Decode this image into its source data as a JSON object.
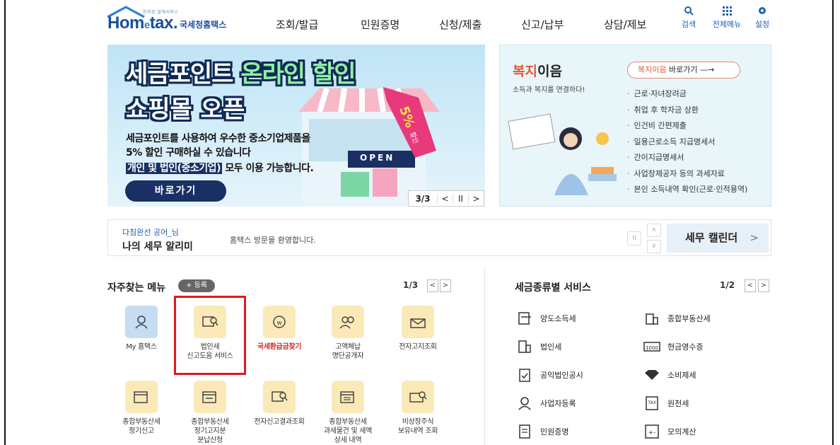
{
  "header": {
    "logo_tagline": "친지랑 발해서비스",
    "logo_brand_home": "Hom",
    "logo_brand_e": "e",
    "logo_brand_tax": "tax.",
    "logo_agency": "국세청홈택스",
    "gnb": [
      "조회/발급",
      "민원증명",
      "신청/제출",
      "신고/납부",
      "상담/제보"
    ],
    "utils": [
      {
        "label": "검색",
        "icon": "search-icon"
      },
      {
        "label": "전체메뉴",
        "icon": "grid-menu-icon"
      },
      {
        "label": "설정",
        "icon": "gear-icon"
      }
    ]
  },
  "banner": {
    "title_line1_a": "세금포인트 ",
    "title_line1_b": "온라인 할인",
    "title_line2": "쇼핑몰 오픈",
    "line1": "세금포인트를 사용하여 우수한 중소기업제품을",
    "line2": "5% 할인 구매하실 수 있습니다",
    "line3_hl": "개인 및 법인(중소기업)",
    "line3_rest": " 모두 이용 가능합니다.",
    "tag_text": "5%",
    "tag_sub": "할인",
    "open_sign": "OPEN",
    "button": "바로가기",
    "page": "3/3",
    "prev": "<",
    "pause": "II",
    "next": ">"
  },
  "welfare": {
    "title_a": "복지",
    "title_b": "이음",
    "subtitle": "소득과 복지를 연결하다!",
    "go_a": "복지이음",
    "go_b": " 바로가기  —→",
    "items": [
      "근로·자녀장려금",
      "취업 후 학자금 상환",
      "인건비 간편제출",
      "일용근로소득 지급명세서",
      "간이지급명세서",
      "사업장제공자 등의 과세자료",
      "본인 소득내역 확인(근로·인적용역)"
    ]
  },
  "notice": {
    "user": "다침완선 공어_님",
    "title": "나의 세무 알리미",
    "message": "홈택스 방문을 환영합니다.",
    "pause": "II",
    "up": "∧",
    "down": "∨",
    "calendar": "세무 캘린더",
    "calendar_arrow": ">"
  },
  "frequent": {
    "title": "자주찾는 메뉴",
    "add": "+ 등록",
    "page": "1/3",
    "prev": "<",
    "next": ">",
    "items": [
      {
        "label": "My 홈택스",
        "icon": "user-icon"
      },
      {
        "label": "법인세\n신고도움 서비스",
        "icon": "document-search-icon"
      },
      {
        "label": "국세환급금찾기",
        "icon": "refund-coin-icon"
      },
      {
        "label": "고액체납\n명단공개자",
        "icon": "people-icon"
      },
      {
        "label": "전자고지조회",
        "icon": "envelope-icon"
      },
      {
        "label": "종합부동산세\n정기신고",
        "icon": "calendar-pen-icon"
      },
      {
        "label": "종합부동산세\n정기고지분\n분납신청",
        "icon": "calendar-check-icon"
      },
      {
        "label": "전자신고결과조회",
        "icon": "document-search-icon"
      },
      {
        "label": "종합부동산세\n과세물건 및 세액\n상세 내역",
        "icon": "calendar-list-icon"
      },
      {
        "label": "비상장주식\n보유내역 조회",
        "icon": "stock-search-icon"
      }
    ]
  },
  "tax_services": {
    "title": "세금종류별 서비스",
    "page": "1/2",
    "prev": "<",
    "next": ">",
    "items": [
      {
        "label": "양도소득세",
        "icon": "transfer-doc-icon"
      },
      {
        "label": "종합부동산세",
        "icon": "building-icon"
      },
      {
        "label": "법인세",
        "icon": "corporation-icon"
      },
      {
        "label": "현금영수증",
        "icon": "receipt-icon"
      },
      {
        "label": "공익법인공시",
        "icon": "clipboard-icon"
      },
      {
        "label": "소비제세",
        "icon": "diamond-icon"
      },
      {
        "label": "사업자등록",
        "icon": "person-icon"
      },
      {
        "label": "원천세",
        "icon": "tax-doc-icon"
      },
      {
        "label": "민원증명",
        "icon": "certificate-icon"
      },
      {
        "label": "모의계산",
        "icon": "calculator-icon"
      }
    ]
  },
  "colors": {
    "brand_blue": "#1c4f9c",
    "navy": "#1a2f63",
    "highlight_red": "#e0191e",
    "icon_bg_yellow": "#fbe9b8",
    "icon_bg_blue": "#c5dcf3"
  }
}
